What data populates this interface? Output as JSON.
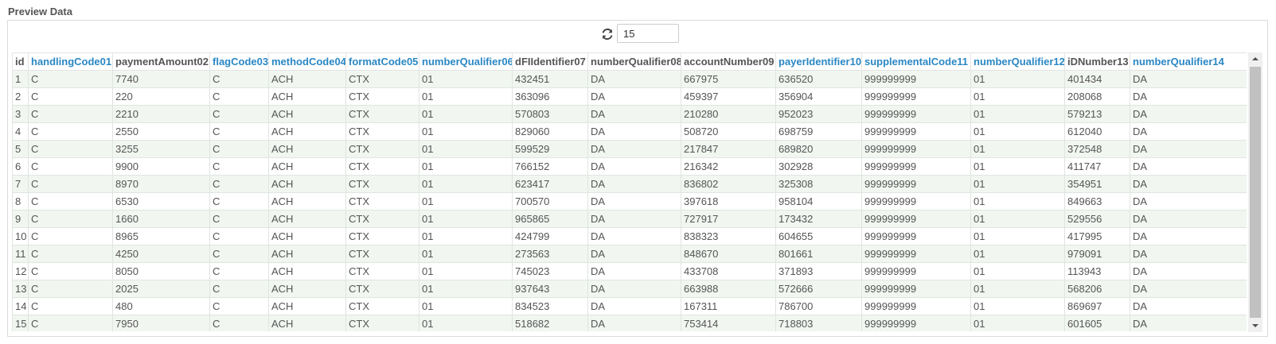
{
  "panel": {
    "title": "Preview Data"
  },
  "toolbar": {
    "refresh_icon": "refresh-icon",
    "rows_value": "15"
  },
  "grid": {
    "columns": [
      {
        "label": "id",
        "link": false
      },
      {
        "label": "handlingCode01",
        "link": true
      },
      {
        "label": "paymentAmount02",
        "link": false
      },
      {
        "label": "flagCode03",
        "link": true
      },
      {
        "label": "methodCode04",
        "link": true
      },
      {
        "label": "formatCode05",
        "link": true
      },
      {
        "label": "numberQualifier06",
        "link": true
      },
      {
        "label": "dFIIdentifier07",
        "link": false
      },
      {
        "label": "numberQualifier08",
        "link": false
      },
      {
        "label": "accountNumber09",
        "link": false
      },
      {
        "label": "payerIdentifier10",
        "link": true
      },
      {
        "label": "supplementalCode11",
        "link": true
      },
      {
        "label": "numberQualifier12",
        "link": true
      },
      {
        "label": "iDNumber13",
        "link": false
      },
      {
        "label": "numberQualifier14",
        "link": true
      }
    ],
    "rows": [
      [
        "1",
        "C",
        "7740",
        "C",
        "ACH",
        "CTX",
        "01",
        "432451",
        "DA",
        "667975",
        "636520",
        "999999999",
        "01",
        "401434",
        "DA"
      ],
      [
        "2",
        "C",
        "220",
        "C",
        "ACH",
        "CTX",
        "01",
        "363096",
        "DA",
        "459397",
        "356904",
        "999999999",
        "01",
        "208068",
        "DA"
      ],
      [
        "3",
        "C",
        "2210",
        "C",
        "ACH",
        "CTX",
        "01",
        "570803",
        "DA",
        "210280",
        "952023",
        "999999999",
        "01",
        "579213",
        "DA"
      ],
      [
        "4",
        "C",
        "2550",
        "C",
        "ACH",
        "CTX",
        "01",
        "829060",
        "DA",
        "508720",
        "698759",
        "999999999",
        "01",
        "612040",
        "DA"
      ],
      [
        "5",
        "C",
        "3255",
        "C",
        "ACH",
        "CTX",
        "01",
        "599529",
        "DA",
        "217847",
        "689820",
        "999999999",
        "01",
        "372548",
        "DA"
      ],
      [
        "6",
        "C",
        "9900",
        "C",
        "ACH",
        "CTX",
        "01",
        "766152",
        "DA",
        "216342",
        "302928",
        "999999999",
        "01",
        "411747",
        "DA"
      ],
      [
        "7",
        "C",
        "8970",
        "C",
        "ACH",
        "CTX",
        "01",
        "623417",
        "DA",
        "836802",
        "325308",
        "999999999",
        "01",
        "354951",
        "DA"
      ],
      [
        "8",
        "C",
        "6530",
        "C",
        "ACH",
        "CTX",
        "01",
        "700570",
        "DA",
        "397618",
        "958104",
        "999999999",
        "01",
        "849663",
        "DA"
      ],
      [
        "9",
        "C",
        "1660",
        "C",
        "ACH",
        "CTX",
        "01",
        "965865",
        "DA",
        "727917",
        "173432",
        "999999999",
        "01",
        "529556",
        "DA"
      ],
      [
        "10",
        "C",
        "8965",
        "C",
        "ACH",
        "CTX",
        "01",
        "424799",
        "DA",
        "838323",
        "604655",
        "999999999",
        "01",
        "417995",
        "DA"
      ],
      [
        "11",
        "C",
        "4250",
        "C",
        "ACH",
        "CTX",
        "01",
        "273563",
        "DA",
        "848670",
        "801661",
        "999999999",
        "01",
        "979091",
        "DA"
      ],
      [
        "12",
        "C",
        "8050",
        "C",
        "ACH",
        "CTX",
        "01",
        "745023",
        "DA",
        "433708",
        "371893",
        "999999999",
        "01",
        "113943",
        "DA"
      ],
      [
        "13",
        "C",
        "2025",
        "C",
        "ACH",
        "CTX",
        "01",
        "937643",
        "DA",
        "663988",
        "572666",
        "999999999",
        "01",
        "568206",
        "DA"
      ],
      [
        "14",
        "C",
        "480",
        "C",
        "ACH",
        "CTX",
        "01",
        "834523",
        "DA",
        "167311",
        "786700",
        "999999999",
        "01",
        "869697",
        "DA"
      ],
      [
        "15",
        "C",
        "7950",
        "C",
        "ACH",
        "CTX",
        "01",
        "518682",
        "DA",
        "753414",
        "718803",
        "999999999",
        "01",
        "601605",
        "DA"
      ]
    ]
  },
  "scrollbar": {
    "up_icon": "scroll-up-arrow-icon",
    "down_icon": "scroll-down-arrow-icon"
  },
  "colors": {
    "link_header": "#2a87c4",
    "odd_row": "#f1f6f1",
    "even_row": "#ffffff",
    "scroll_thumb": "#c1c1c1"
  }
}
